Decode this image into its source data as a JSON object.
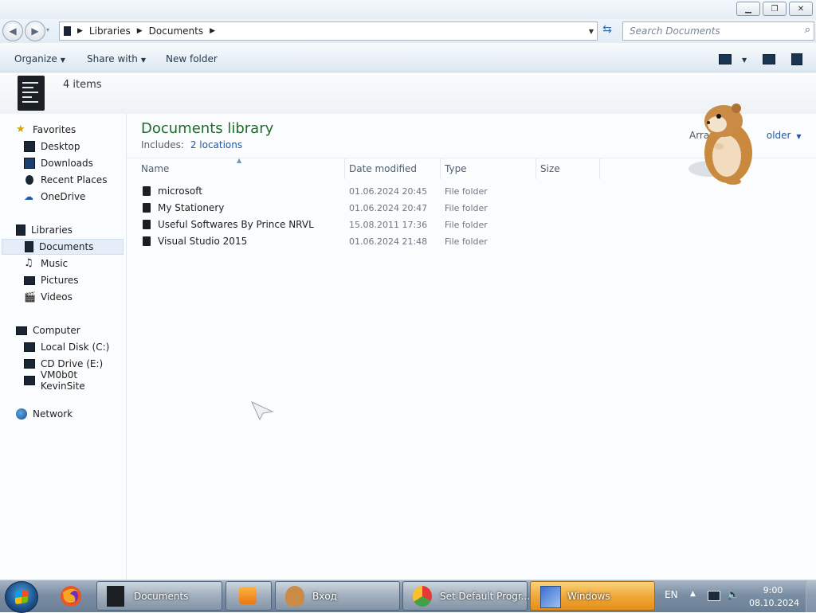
{
  "address": {
    "crumbs": [
      "Libraries",
      "Documents"
    ]
  },
  "search": {
    "placeholder": "Search Documents"
  },
  "toolbar": {
    "organize": "Organize",
    "share_with": "Share with",
    "new_folder": "New folder"
  },
  "details": {
    "item_count": "4 items"
  },
  "nav": {
    "favorites": "Favorites",
    "favorites_items": [
      "Desktop",
      "Downloads",
      "Recent Places",
      "OneDrive"
    ],
    "libraries": "Libraries",
    "libraries_items": [
      "Documents",
      "Music",
      "Pictures",
      "Videos"
    ],
    "computer": "Computer",
    "computer_items": [
      "Local Disk (C:)",
      "CD Drive (E:)",
      "VM0b0t KevinSite"
    ],
    "network": "Network"
  },
  "library": {
    "title": "Documents library",
    "includes_label": "Includes:",
    "includes_link": "2 locations",
    "arrange_visible": "Arra",
    "arrange_tail": "older"
  },
  "columns": [
    "Name",
    "Date modified",
    "Type",
    "Size"
  ],
  "files": [
    {
      "name": "microsoft",
      "date": "01.06.2024 20:45",
      "type": "File folder"
    },
    {
      "name": "My Stationery",
      "date": "01.06.2024 20:47",
      "type": "File folder"
    },
    {
      "name": "Useful Softwares By Prince NRVL",
      "date": "15.08.2011 17:36",
      "type": "File folder"
    },
    {
      "name": "Visual Studio 2015",
      "date": "01.06.2024 21:48",
      "type": "File folder"
    }
  ],
  "taskbar": {
    "buttons": [
      "Documents",
      "",
      "Вход",
      "Set Default Progr...",
      "Windows"
    ],
    "lang": "EN",
    "time": "9:00",
    "date": "08.10.2024"
  }
}
